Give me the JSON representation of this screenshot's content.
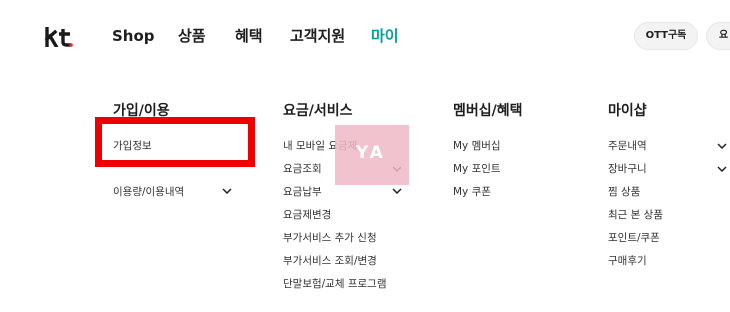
{
  "header": {
    "logo_text": "kt",
    "nav": [
      {
        "label": "Shop"
      },
      {
        "label": "상품"
      },
      {
        "label": "혜택"
      },
      {
        "label": "고객지원"
      },
      {
        "label": "마이"
      }
    ],
    "active_nav_color": "#01a29a",
    "pills": [
      {
        "label": "OTT구독"
      },
      {
        "label": "요"
      }
    ]
  },
  "menu": {
    "columns": [
      {
        "title": "가입/이용",
        "items": [
          {
            "label": "가입정보"
          },
          {
            "label": "이용량/이용내역",
            "has_dropdown": true
          }
        ]
      },
      {
        "title": "요금/서비스",
        "items": [
          {
            "label": "내 모바일 요금제"
          },
          {
            "label": "요금조회",
            "has_dropdown": true
          },
          {
            "label": "요금납부",
            "has_dropdown": true
          },
          {
            "label": "요금제변경"
          },
          {
            "label": "부가서비스 추가 신청"
          },
          {
            "label": "부가서비스 조회/변경"
          },
          {
            "label": "단말보험/교체 프로그램"
          }
        ]
      },
      {
        "title": "멤버십/혜택",
        "items": [
          {
            "label": "My 멤버십"
          },
          {
            "label": "My 포인트"
          },
          {
            "label": "My 쿠폰"
          }
        ]
      },
      {
        "title": "마이샵",
        "items": [
          {
            "label": "주문내역",
            "has_dropdown": true
          },
          {
            "label": "장바구니",
            "has_dropdown": true
          },
          {
            "label": "찜 상품"
          },
          {
            "label": "최근 본 상품"
          },
          {
            "label": "포인트/쿠폰"
          },
          {
            "label": "구매후기"
          }
        ]
      }
    ]
  },
  "overlay": {
    "highlight_color": "#ee0000",
    "watermark_color": "#efb9c6",
    "watermark_text": "YA"
  }
}
